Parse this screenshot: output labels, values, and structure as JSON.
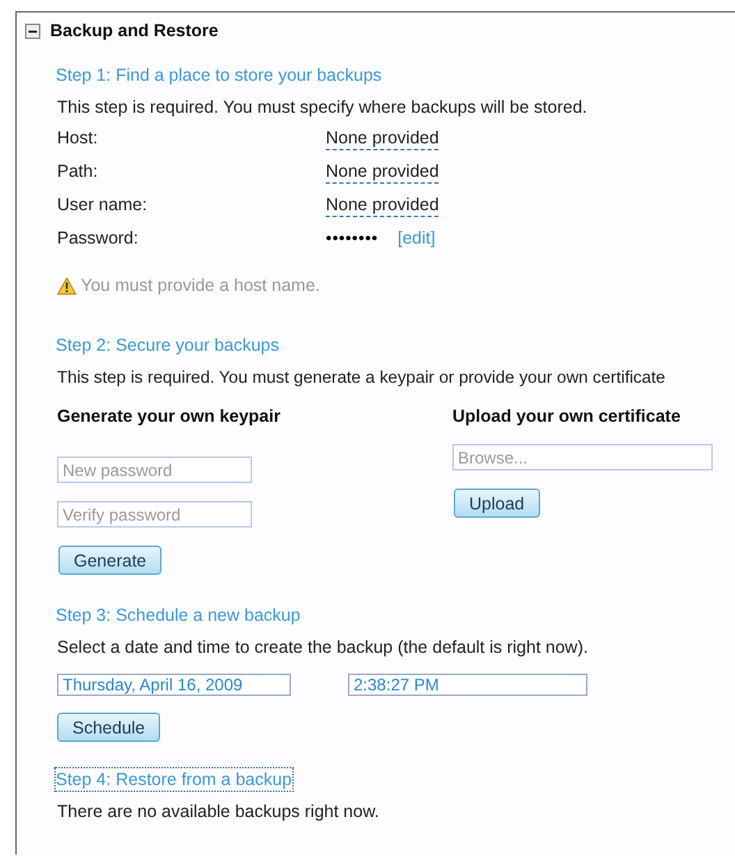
{
  "section": {
    "title": "Backup and Restore",
    "expanded": true
  },
  "steps": [
    {
      "kind": "location",
      "heading": "Step 1: Find a place to store your backups",
      "focused": false,
      "description": "This step is required. You must specify where backups will be stored.",
      "fields": [
        {
          "kind": "editable",
          "label": "Host:",
          "value": "None provided"
        },
        {
          "kind": "editable",
          "label": "Path:",
          "value": "None provided"
        },
        {
          "kind": "editable",
          "label": "User name:",
          "value": "None provided"
        },
        {
          "kind": "masked",
          "label": "Password:",
          "value": "••••••••",
          "link": "[edit]"
        }
      ],
      "warning": "You must provide a host name."
    },
    {
      "kind": "keys",
      "heading": "Step 2: Secure your backups",
      "focused": false,
      "description": "This step is required. You must generate a keypair or provide your own certificate",
      "columns": [
        {
          "title": "Generate your own keypair",
          "inputs": [
            {
              "placeholder": "New password"
            },
            {
              "placeholder": "Verify password"
            }
          ],
          "button": "Generate"
        },
        {
          "title": "Upload your own certificate",
          "inputs": [
            {
              "placeholder": "Browse..."
            }
          ],
          "button": "Upload"
        }
      ]
    },
    {
      "kind": "schedule",
      "heading": "Step 3: Schedule a new backup",
      "focused": false,
      "description": "Select a date and time to create the backup (the default is right now).",
      "inputs": [
        {
          "value": "Thursday, April 16, 2009"
        },
        {
          "value": "2:38:27 PM"
        }
      ],
      "button": "Schedule"
    },
    {
      "kind": "restore",
      "heading": "Step 4: Restore from a backup",
      "focused": true,
      "description": "There are no available backups right now."
    }
  ]
}
